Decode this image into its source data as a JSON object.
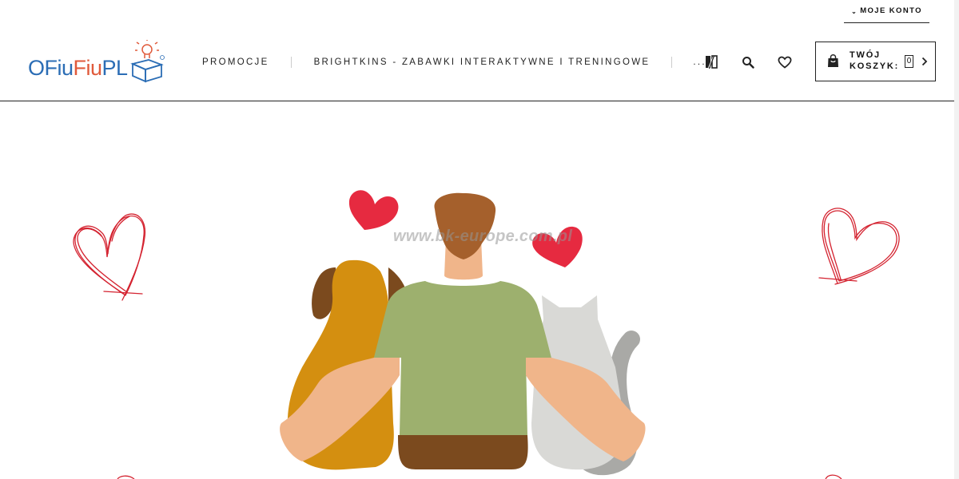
{
  "account": {
    "label": "MOJE KONTO"
  },
  "logo": {
    "alt": "OFiuFiuPL",
    "part_o": "O",
    "part_fiu1": "Fiu",
    "part_fiu2": "Fiu",
    "part_pl": "PL"
  },
  "nav": {
    "items": [
      {
        "label": "PROMOCJE"
      },
      {
        "label": "BRIGHTKINS - ZABAWKI INTERAKTYWNE I TRENINGOWE"
      },
      {
        "label": "..."
      }
    ]
  },
  "header_icons": [
    "compare-icon",
    "search-icon",
    "heart-icon"
  ],
  "cart": {
    "label_line1": "TWÓJ",
    "label_line2": "KOSZYK:",
    "count": "0"
  },
  "hero": {
    "watermark": "www.bk-europe.com.pl"
  },
  "colors": {
    "logo_blue": "#2b6db5",
    "logo_orange": "#e05a3b",
    "heart_red": "#e62a40",
    "dog_orange": "#d48f10",
    "shirt_green": "#9db06e",
    "hair_brown": "#a5602c"
  }
}
